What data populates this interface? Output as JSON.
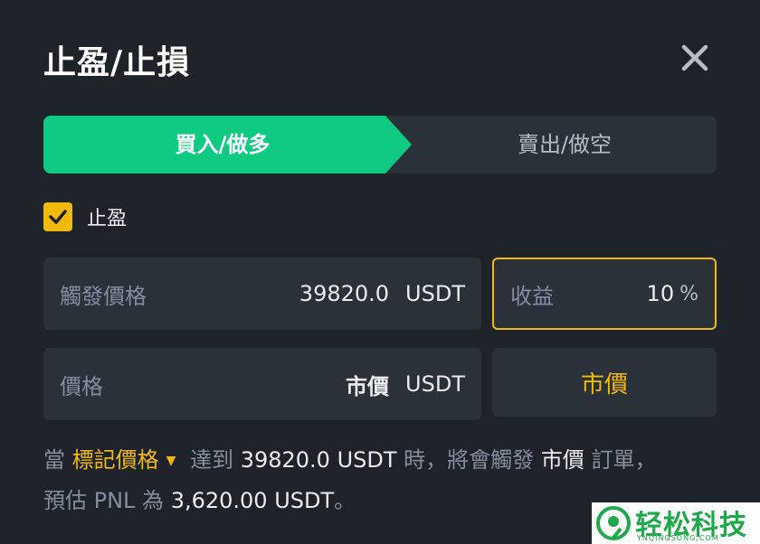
{
  "dialog": {
    "title": "止盈/止損"
  },
  "side_tabs": {
    "buy_label": "買入/做多",
    "sell_label": "賣出/做空"
  },
  "take_profit": {
    "checkbox_label": "止盈",
    "checked": true
  },
  "trigger_price": {
    "label": "觸發價格",
    "value": "39820.0",
    "unit": "USDT"
  },
  "profit": {
    "label": "收益",
    "value": "10",
    "unit": "%"
  },
  "order_price": {
    "label": "價格",
    "value": "市價",
    "unit": "USDT"
  },
  "market_button": {
    "label": "市價"
  },
  "description": {
    "prefix": "當",
    "price_type": "標記價格",
    "reach": "達到",
    "amount": "39820.0 USDT",
    "mid": "時，將會觸發",
    "order_type": "市價",
    "suffix": "訂單，預估 PNL 為",
    "pnl": "3,620.00 USDT",
    "end": "。"
  },
  "watermark": {
    "text": "轻松科技",
    "sub": "YNQINGSONG.COM"
  },
  "colors": {
    "background": "#1e2329",
    "panel": "#2b3139",
    "buy_green": "#0ecb81",
    "accent_yellow": "#f0b90b",
    "muted_text": "#848e9c"
  }
}
